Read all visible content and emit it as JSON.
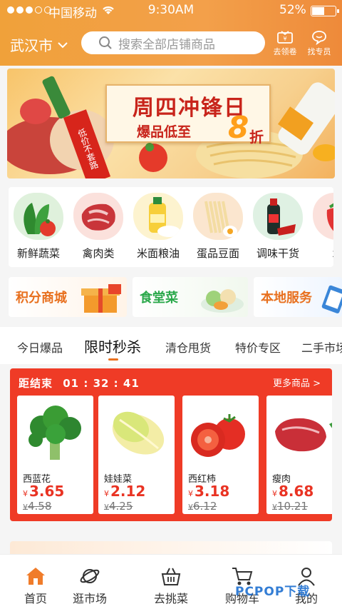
{
  "status_bar": {
    "carrier": "中国移动",
    "time": "9:30AM",
    "battery": "52%"
  },
  "header": {
    "city": "武汉市",
    "search_placeholder": "搜索全部店铺商品",
    "coupon_label": "去领卷",
    "expert_label": "找专员"
  },
  "banner": {
    "title": "周四冲锋日",
    "subtitle": "爆品低至",
    "discount_number": "8",
    "discount_unit": "折",
    "ribbon": "低价不套路"
  },
  "categories": [
    {
      "label": "新鲜蔬菜"
    },
    {
      "label": "禽肉类"
    },
    {
      "label": "米面粮油"
    },
    {
      "label": "蛋品豆面"
    },
    {
      "label": "调味干货"
    },
    {
      "label": "水"
    }
  ],
  "services": [
    {
      "label": "积分商城"
    },
    {
      "label": "食堂菜"
    },
    {
      "label": "本地服务"
    }
  ],
  "tabs": [
    {
      "label": "今日爆品"
    },
    {
      "label": "限时秒杀"
    },
    {
      "label": "清仓甩货"
    },
    {
      "label": "特价专区"
    },
    {
      "label": "二手市场"
    }
  ],
  "active_tab": "限时秒杀",
  "flash_sale": {
    "countdown_label": "距结束",
    "countdown": "01 : 32 : 41",
    "more_label": "更多商品 >",
    "currency": "¥",
    "products": [
      {
        "name": "西蓝花",
        "price": "3.65",
        "old_price": "4.58"
      },
      {
        "name": "娃娃菜",
        "price": "2.12",
        "old_price": "4.25"
      },
      {
        "name": "西红柿",
        "price": "3.18",
        "old_price": "6.12"
      },
      {
        "name": "瘦肉",
        "price": "8.68",
        "old_price": "10.21"
      }
    ]
  },
  "bottom_nav": [
    {
      "label": "首页"
    },
    {
      "label": "逛市场"
    },
    {
      "label": "去挑菜"
    },
    {
      "label": "购物车"
    },
    {
      "label": "我的"
    }
  ],
  "watermark": "PCPOP下载",
  "colors": {
    "brand_orange": "#f0a13a",
    "price_red": "#e93323",
    "flash_bg": "#ef3b26",
    "accent": "#e8701e"
  }
}
